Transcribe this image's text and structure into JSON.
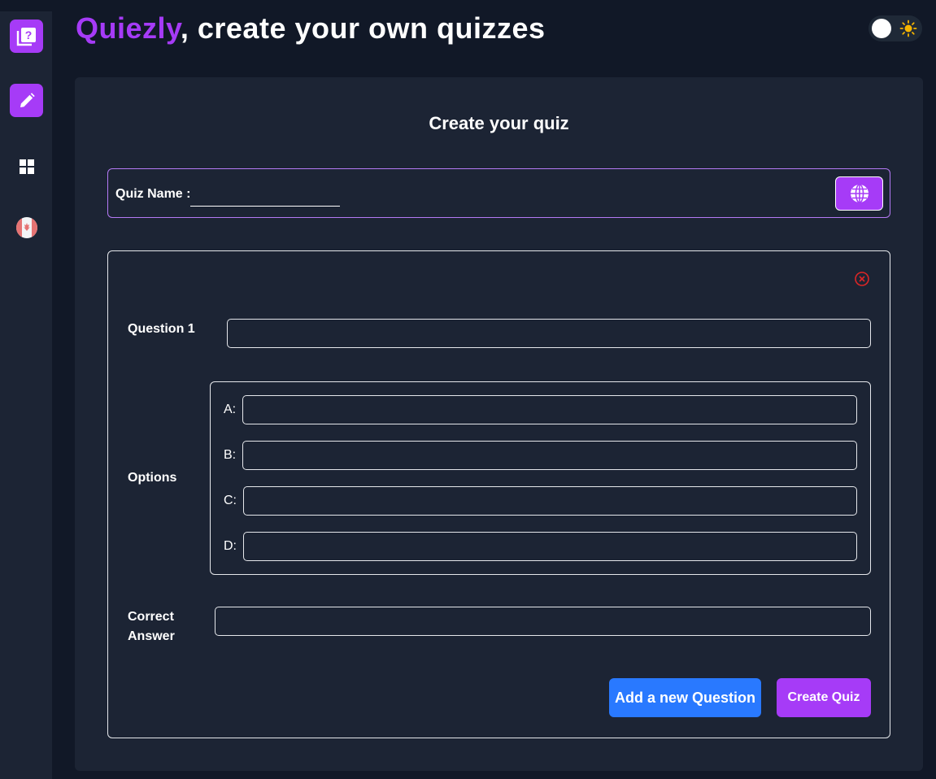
{
  "header": {
    "brand": "Quiezly",
    "tagline": ", create your own quizzes"
  },
  "sidebar": {
    "items": [
      {
        "icon": "quiz-book-icon",
        "active": true
      },
      {
        "icon": "pencil-icon",
        "active": true
      },
      {
        "icon": "grid-icon",
        "active": false
      },
      {
        "icon": "flag-icon",
        "active": false
      }
    ]
  },
  "theme_toggle": {
    "icon": "sun-icon",
    "state": "off"
  },
  "form": {
    "title": "Create your quiz",
    "quiz_name_label": "Quiz Name :",
    "quiz_name_value": "",
    "globe_icon": "globe-icon",
    "question": {
      "label": "Question 1",
      "value": "",
      "options_label": "Options",
      "options": [
        {
          "label": "A:",
          "value": ""
        },
        {
          "label": "B:",
          "value": ""
        },
        {
          "label": "C:",
          "value": ""
        },
        {
          "label": "D:",
          "value": ""
        }
      ],
      "correct_answer_label_line1": "Correct",
      "correct_answer_label_line2": "Answer",
      "correct_answer_value": ""
    },
    "add_question_label": "Add a new Question",
    "create_quiz_label": "Create Quiz"
  },
  "colors": {
    "background": "#111827",
    "card": "#1c2434",
    "accent": "#a63bf7",
    "blue": "#2979ff",
    "danger": "#dc2626"
  }
}
